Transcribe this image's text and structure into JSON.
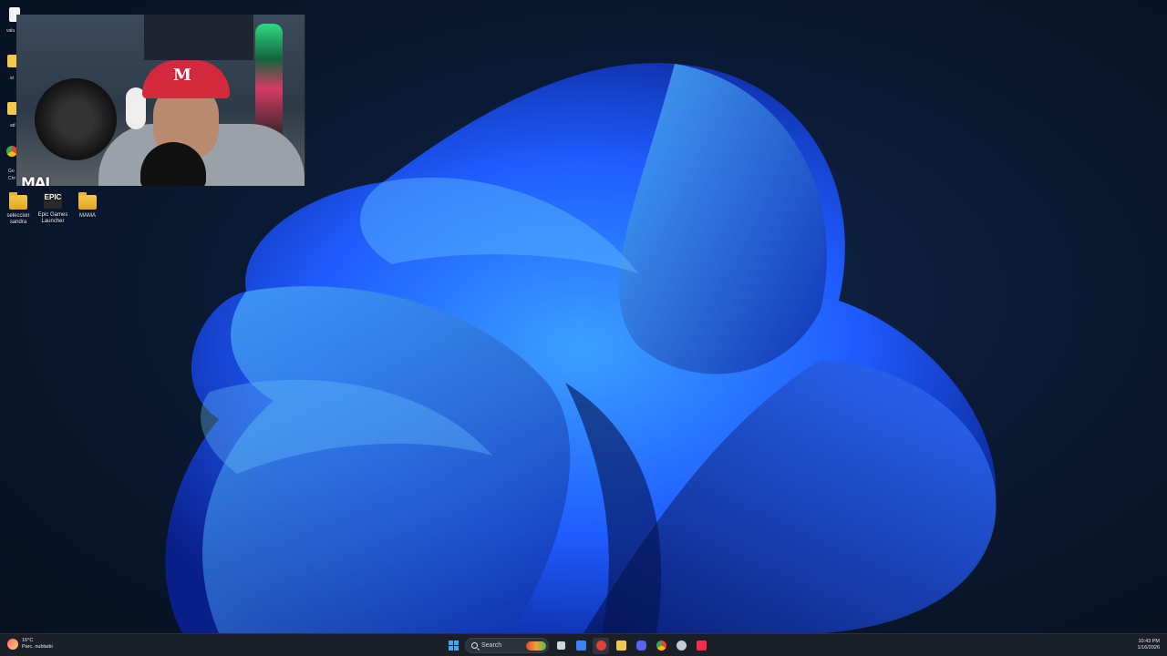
{
  "desktop": {
    "icons": [
      {
        "label": "seleccion sandra"
      },
      {
        "label": "Epic Games Launcher",
        "glyph": "EPIC"
      },
      {
        "label": "MAMA"
      }
    ],
    "partial_labels": [
      "valu",
      "st",
      "ad",
      "Go",
      "Chr"
    ]
  },
  "webcam": {
    "channel_tag": "MAI",
    "cap_logo": "M"
  },
  "taskbar": {
    "weather": {
      "temperature": "16°C",
      "condition": "Parc. nublado",
      "icon": "weather-icon"
    },
    "search": {
      "placeholder": "Search"
    },
    "pinned_apps": [
      {
        "name": "start-icon",
        "color": "#3fa7f5"
      },
      {
        "name": "task-view-icon",
        "color": "#d0d4db"
      },
      {
        "name": "mail-icon",
        "color": "#3b82f6"
      },
      {
        "name": "media-player-icon",
        "color": "#e0413f"
      },
      {
        "name": "file-explorer-icon",
        "color": "#f2c94c"
      },
      {
        "name": "discord-icon",
        "color": "#5865f2"
      },
      {
        "name": "chrome-icon",
        "color": "#34a853"
      },
      {
        "name": "settings-icon",
        "color": "#c7ccd5"
      },
      {
        "name": "apple-music-icon",
        "color": "#fa2d48"
      }
    ],
    "clock": {
      "time": "10:43 PM",
      "date": "1/16/2026"
    }
  },
  "colors": {
    "wallpaper_base": "#0b1a33",
    "bloom_blue": "#1f5cff",
    "taskbar_bg": "#1b1f27"
  }
}
